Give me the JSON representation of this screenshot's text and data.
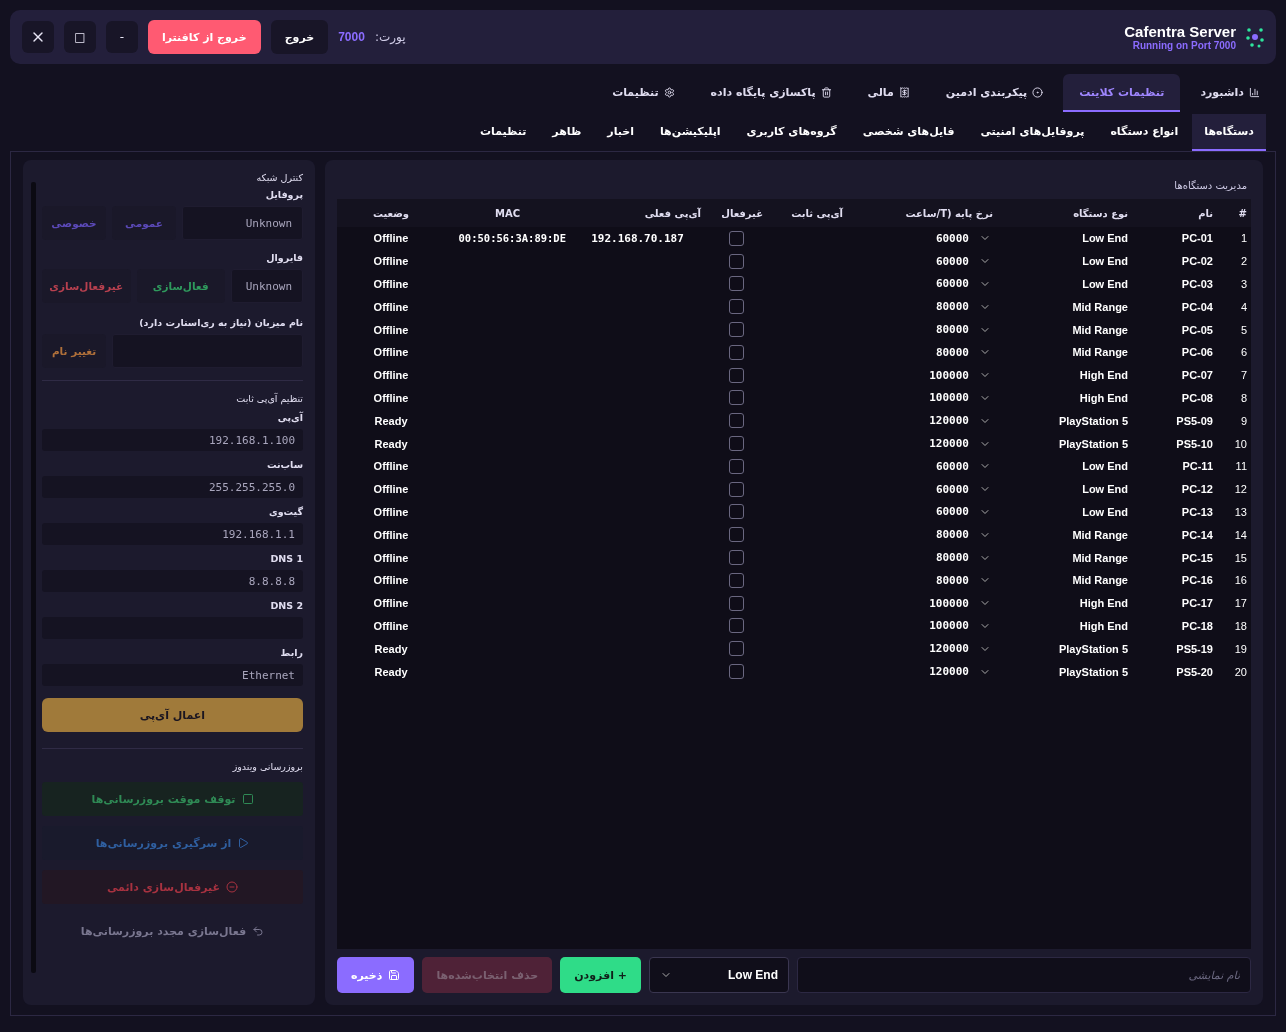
{
  "app": {
    "title": "Cafentra Server",
    "subtitle": "Running on Port 7000"
  },
  "port": {
    "label": "پورت:",
    "value": "7000"
  },
  "header_buttons": [
    {
      "kind": "plain",
      "label": "خروج"
    },
    {
      "kind": "danger",
      "label": "خروج از کافنترا"
    }
  ],
  "window_controls": [
    "-",
    "□"
  ],
  "main_tabs": [
    {
      "label": "داشبورد",
      "selected": false
    },
    {
      "label": "تنظیمات کلاینت",
      "selected": true
    },
    {
      "label": "پیکربندی ادمین",
      "selected": false
    },
    {
      "label": "مالی",
      "selected": false
    },
    {
      "label": "پاکسازی پایگاه داده",
      "selected": false
    },
    {
      "label": "تنظیمات",
      "selected": false
    }
  ],
  "sub_tabs": [
    {
      "label": "دستگاه‌ها",
      "selected": true
    },
    {
      "label": "انواع دستگاه",
      "selected": false
    },
    {
      "label": "پروفایل‌های امنیتی",
      "selected": false
    },
    {
      "label": "فایل‌های شخصی",
      "selected": false
    },
    {
      "label": "گروه‌های کاربری",
      "selected": false
    },
    {
      "label": "اپلیکیشن‌ها",
      "selected": false
    },
    {
      "label": "اخبار",
      "selected": false
    },
    {
      "label": "ظاهر",
      "selected": false
    },
    {
      "label": "تنظیمات",
      "selected": false
    }
  ],
  "network_panel": {
    "title": "کنترل شبکه",
    "profile": {
      "label": "پروفایل",
      "value": "Unknown",
      "buttons": [
        {
          "kind": "purple",
          "label": "عمومی"
        },
        {
          "kind": "purple",
          "label": "خصوصی"
        }
      ]
    },
    "firewall": {
      "label": "فایروال",
      "value": "Unknown",
      "buttons": [
        {
          "kind": "green",
          "label": "فعال‌سازی"
        },
        {
          "kind": "red",
          "label": "غیرفعال‌سازی"
        }
      ]
    },
    "hostname": {
      "label": "نام میزبان (نیاز به ری‌استارت دارد)",
      "button": "تغییر نام"
    },
    "static_ip": {
      "title": "تنظیم آی‌پی ثابت",
      "fields": [
        {
          "label": "آی‌پی",
          "value": "192.168.1.100"
        },
        {
          "label": "ساب‌نت",
          "value": "255.255.255.0"
        },
        {
          "label": "گیت‌وی",
          "value": "192.168.1.1"
        },
        {
          "label": "DNS 1",
          "value": "8.8.8.8"
        },
        {
          "label": "DNS 2"
        },
        {
          "label": "رابط",
          "value": "Ethernet"
        }
      ],
      "apply": "اعمال آی‌پی"
    },
    "windows_update": {
      "title": "بروزرسانی ویندوز",
      "actions": [
        {
          "kind": "pause",
          "label": "توقف موقت بروزرسانی‌ها"
        },
        {
          "kind": "resume",
          "label": "از سرگیری بروزرسانی‌ها"
        },
        {
          "kind": "disable",
          "label": "غیرفعال‌سازی دائمی"
        },
        {
          "kind": "enable",
          "label": "فعال‌سازی مجدد بروزرسانی‌ها"
        }
      ]
    }
  },
  "devices": {
    "title": "مدیریت دستگاه‌ها",
    "columns": [
      "#",
      "نام",
      "نوع دستگاه",
      "نرخ پایه (T/ساعت",
      "آی‌پی ثابت",
      "غیرفعال",
      "آی‌پی فعلی",
      "MAC",
      "وضعیت"
    ],
    "rows": [
      {
        "index": "1",
        "name": "PC-01",
        "type": "Low End",
        "rate": "60000",
        "disabled": false,
        "current_ip": "192.168.70.187",
        "mac": "00:50:56:3A:89:DE",
        "status": "Offline"
      },
      {
        "index": "2",
        "name": "PC-02",
        "type": "Low End",
        "rate": "60000",
        "disabled": false,
        "status": "Offline"
      },
      {
        "index": "3",
        "name": "PC-03",
        "type": "Low End",
        "rate": "60000",
        "disabled": false,
        "status": "Offline"
      },
      {
        "index": "4",
        "name": "PC-04",
        "type": "Mid Range",
        "rate": "80000",
        "disabled": false,
        "status": "Offline"
      },
      {
        "index": "5",
        "name": "PC-05",
        "type": "Mid Range",
        "rate": "80000",
        "disabled": false,
        "status": "Offline"
      },
      {
        "index": "6",
        "name": "PC-06",
        "type": "Mid Range",
        "rate": "80000",
        "disabled": false,
        "status": "Offline"
      },
      {
        "index": "7",
        "name": "PC-07",
        "type": "High End",
        "rate": "100000",
        "disabled": false,
        "status": "Offline"
      },
      {
        "index": "8",
        "name": "PC-08",
        "type": "High End",
        "rate": "100000",
        "disabled": false,
        "status": "Offline"
      },
      {
        "index": "9",
        "name": "PS5-09",
        "type": "PlayStation 5",
        "rate": "120000",
        "disabled": false,
        "status": "Ready"
      },
      {
        "index": "10",
        "name": "PS5-10",
        "type": "PlayStation 5",
        "rate": "120000",
        "disabled": false,
        "status": "Ready"
      },
      {
        "index": "11",
        "name": "PC-11",
        "type": "Low End",
        "rate": "60000",
        "disabled": false,
        "status": "Offline"
      },
      {
        "index": "12",
        "name": "PC-12",
        "type": "Low End",
        "rate": "60000",
        "disabled": false,
        "status": "Offline"
      },
      {
        "index": "13",
        "name": "PC-13",
        "type": "Low End",
        "rate": "60000",
        "disabled": false,
        "status": "Offline"
      },
      {
        "index": "14",
        "name": "PC-14",
        "type": "Mid Range",
        "rate": "80000",
        "disabled": false,
        "status": "Offline"
      },
      {
        "index": "15",
        "name": "PC-15",
        "type": "Mid Range",
        "rate": "80000",
        "disabled": false,
        "status": "Offline"
      },
      {
        "index": "16",
        "name": "PC-16",
        "type": "Mid Range",
        "rate": "80000",
        "disabled": false,
        "status": "Offline"
      },
      {
        "index": "17",
        "name": "PC-17",
        "type": "High End",
        "rate": "100000",
        "disabled": false,
        "status": "Offline"
      },
      {
        "index": "18",
        "name": "PC-18",
        "type": "High End",
        "rate": "100000",
        "disabled": false,
        "status": "Offline"
      },
      {
        "index": "19",
        "name": "PS5-19",
        "type": "PlayStation 5",
        "rate": "120000",
        "disabled": false,
        "status": "Ready"
      },
      {
        "index": "20",
        "name": "PS5-20",
        "type": "PlayStation 5",
        "rate": "120000",
        "disabled": false,
        "status": "Ready"
      }
    ]
  },
  "add_form": {
    "name_placeholder": "نام نمایشی",
    "type": "Low End",
    "add": "+ افزودن",
    "delete": {
      "label": "حذف انتخاب‌شده‌ها",
      "disabled": true
    },
    "save": "ذخیره"
  }
}
